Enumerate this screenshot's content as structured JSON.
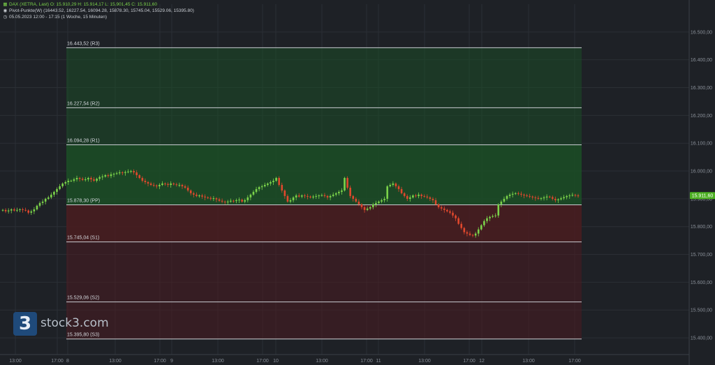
{
  "header": {
    "instrument_line": "DAX (XETRA, Last)  O: 15.910,29  H: 15.914,17  L: 15.901,45  C: 15.911,60",
    "indicator_line": "Pivot-Punkte(W)  (16443.52,  16227.54,  16094.28,  15878.30,  15745.04,  15529.06,  15395.80)",
    "period_line": "05.05.2023 12:00 - 17:15   (1 Woche, 15 Minuten)",
    "icons": [
      "chart-icon",
      "indicator-icon",
      "clock-icon"
    ]
  },
  "logo": {
    "mark": "3",
    "text": "stock3.com"
  },
  "chart_data": {
    "type": "candlestick",
    "y_range": [
      15360,
      16600
    ],
    "y_ticks": [
      {
        "v": 16500,
        "label": "16.500,00"
      },
      {
        "v": 16400,
        "label": "16.400,00"
      },
      {
        "v": 16300,
        "label": "16.300,00"
      },
      {
        "v": 16200,
        "label": "16.200,00"
      },
      {
        "v": 16100,
        "label": "16.100,00"
      },
      {
        "v": 16000,
        "label": "16.000,00"
      },
      {
        "v": 15900,
        "label": "15.900,00"
      },
      {
        "v": 15800,
        "label": "15.800,00"
      },
      {
        "v": 15700,
        "label": "15.700,00"
      },
      {
        "v": 15600,
        "label": "15.600,00"
      },
      {
        "v": 15500,
        "label": "15.500,00"
      },
      {
        "v": 15400,
        "label": "15.400,00"
      }
    ],
    "x_labels": [
      "13:00",
      "17:00",
      "8",
      "13:00",
      "17:00",
      "9",
      "13:00",
      "17:00",
      "10",
      "13:00",
      "17:00",
      "11",
      "13:00",
      "17:00",
      "12",
      "13:00",
      "17:00"
    ],
    "last_price": {
      "value": 15911.6,
      "label": "15.911,60"
    },
    "pivot_levels": [
      {
        "name": "R3",
        "value": 16443.52,
        "label": "16.443,52 (R3)"
      },
      {
        "name": "R2",
        "value": 16227.54,
        "label": "16.227,54 (R2)"
      },
      {
        "name": "R1",
        "value": 16094.28,
        "label": "16.094,28 (R1)"
      },
      {
        "name": "PP",
        "value": 15878.3,
        "label": "15.878,30 (PP)"
      },
      {
        "name": "S1",
        "value": 15745.04,
        "label": "15.745,04 (S1)"
      },
      {
        "name": "S2",
        "value": 15529.06,
        "label": "15.529,06 (S2)"
      },
      {
        "name": "S3",
        "value": 15395.8,
        "label": "15.395,80 (S3)"
      }
    ],
    "colors": {
      "up": "#7bd34a",
      "down": "#e0482d",
      "resistance_zone": "#1b4d26",
      "support_zone": "#4a1c20",
      "last_price_bg": "#4caf22"
    },
    "close_series": [
      15860,
      15855,
      15858,
      15862,
      15858,
      15860,
      15862,
      15860,
      15858,
      15850,
      15855,
      15862,
      15875,
      15885,
      15890,
      15900,
      15905,
      15915,
      15925,
      15935,
      15945,
      15955,
      15960,
      15965,
      15965,
      15970,
      15975,
      15972,
      15968,
      15970,
      15975,
      15970,
      15965,
      15972,
      15978,
      15980,
      15985,
      15982,
      15988,
      15990,
      15992,
      15995,
      15993,
      15996,
      15998,
      16000,
      15995,
      15985,
      15975,
      15965,
      15960,
      15955,
      15950,
      15948,
      15945,
      15950,
      15955,
      15953,
      15950,
      15955,
      15952,
      15950,
      15950,
      15945,
      15940,
      15930,
      15920,
      15915,
      15910,
      15912,
      15908,
      15905,
      15903,
      15900,
      15902,
      15898,
      15893,
      15890,
      15888,
      15890,
      15893,
      15892,
      15895,
      15897,
      15890,
      15895,
      15905,
      15915,
      15925,
      15935,
      15942,
      15945,
      15950,
      15955,
      15960,
      15965,
      15975,
      15950,
      15930,
      15910,
      15890,
      15895,
      15905,
      15912,
      15908,
      15912,
      15910,
      15908,
      15905,
      15908,
      15910,
      15912,
      15913,
      15910,
      15905,
      15910,
      15915,
      15920,
      15925,
      15930,
      15975,
      15940,
      15910,
      15900,
      15890,
      15880,
      15870,
      15860,
      15865,
      15870,
      15880,
      15885,
      15890,
      15895,
      15900,
      15945,
      15950,
      15955,
      15945,
      15935,
      15920,
      15910,
      15900,
      15905,
      15912,
      15910,
      15915,
      15910,
      15908,
      15905,
      15900,
      15895,
      15880,
      15870,
      15865,
      15860,
      15855,
      15850,
      15840,
      15830,
      15810,
      15795,
      15780,
      15775,
      15770,
      15768,
      15775,
      15790,
      15805,
      15820,
      15830,
      15835,
      15838,
      15840,
      15880,
      15890,
      15900,
      15910,
      15915,
      15918,
      15920,
      15918,
      15915,
      15912,
      15910,
      15908,
      15905,
      15903,
      15900,
      15902,
      15905,
      15908,
      15906,
      15900,
      15895,
      15898,
      15902,
      15906,
      15910,
      15912,
      15914,
      15912,
      15911.6
    ]
  }
}
